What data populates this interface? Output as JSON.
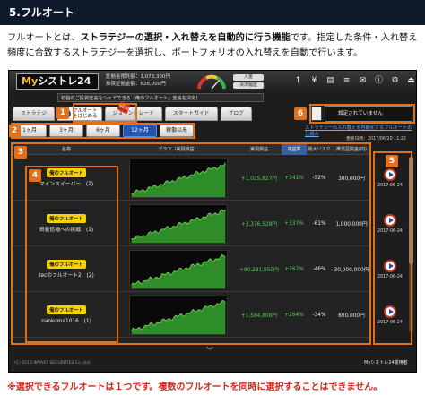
{
  "section_title": "5.フルオート",
  "intro": {
    "p1": "フルオートとは、",
    "strong": "ストラテジーの選択・入れ替えを自動的に行う機能",
    "p2": "です。指定した条件・入れ替え頻度に合致するストラテジーを選択し、ポートフォリオの入れ替えを自動で行います。"
  },
  "app": {
    "logo_my": "My",
    "logo_rest": "シストレ24",
    "account": {
      "line1": "証拠金預託額：1,073,300円",
      "line2": "推奨証拠金額：626,000円"
    },
    "header_buttons": [
      "入金",
      "決済履歴"
    ],
    "tool_icons": [
      "arrow-up-icon",
      "yen-icon",
      "document-icon",
      "list-icon",
      "mail-icon",
      "info-icon",
      "settings-icon",
      "logout-icon"
    ],
    "notice": "初詣のご投資宣言をシェアできる「俺のフルオート」宣言を決定！"
  },
  "tabs": [
    {
      "label": "ストラテジ"
    },
    {
      "label_1": "フルオート",
      "label_2": "をはじめる",
      "active": true
    },
    {
      "label": "ジョイントレード"
    },
    {
      "label": "スタートガイド"
    },
    {
      "label": "ブログ"
    }
  ],
  "new_badge": "NEW",
  "status_text": "設定されていません",
  "periods": [
    "1ヶ月",
    "3ヶ月",
    "6ヶ月",
    "12ヶ月",
    "稼働以来"
  ],
  "active_period": 3,
  "links": {
    "top": "ストラテジーの入れ替えを自動化するフルオートの仕組み",
    "bottom": "Myシストレ24運用者"
  },
  "updated": "更新日時：2017/06/20 11:22",
  "columns": [
    "名称",
    "グラフ（実現損益）",
    "実現損益",
    "収益率",
    "最大リスク",
    "推奨証拠金(円)"
  ],
  "rows": [
    {
      "badge": "俺のフルオート",
      "name": "マインスイーパー　(2)",
      "profit": "+1,025,827円",
      "rate": "+341%",
      "risk": "-52%",
      "margin": "300,000円",
      "date": "2017-06-24"
    },
    {
      "badge": "俺のフルオート",
      "name": "資産倍増への挑戦　(1)",
      "profit": "+3,376,528円",
      "rate": "+337%",
      "risk": "-61%",
      "margin": "1,000,000円",
      "date": "2017-06-24"
    },
    {
      "badge": "俺のフルオート",
      "name": "tecのフルオート2　(2)",
      "profit": "+80,231,050円",
      "rate": "+267%",
      "risk": "-46%",
      "margin": "30,000,000円",
      "date": "2017-06-24"
    },
    {
      "badge": "俺のフルオート",
      "name": "naokuma1016　(1)",
      "profit": "+1,584,808円",
      "rate": "+264%",
      "risk": "-34%",
      "margin": "600,000円",
      "date": "2017-06-24"
    }
  ],
  "more_arrow": "︾",
  "copyright": "(C) 2013 INVAST SECURITIES Co.,Ltd.",
  "annotation_numbers": [
    "1",
    "2",
    "3",
    "4",
    "5",
    "6"
  ],
  "footnote": "※選択できるフルオートは１つです。複数のフルオートを同時に選択することはできません。",
  "colors": {
    "accent": "#e0711c",
    "header_bg": "#0e1a2c",
    "positive": "#52d24f",
    "footnote": "#d0271b"
  }
}
